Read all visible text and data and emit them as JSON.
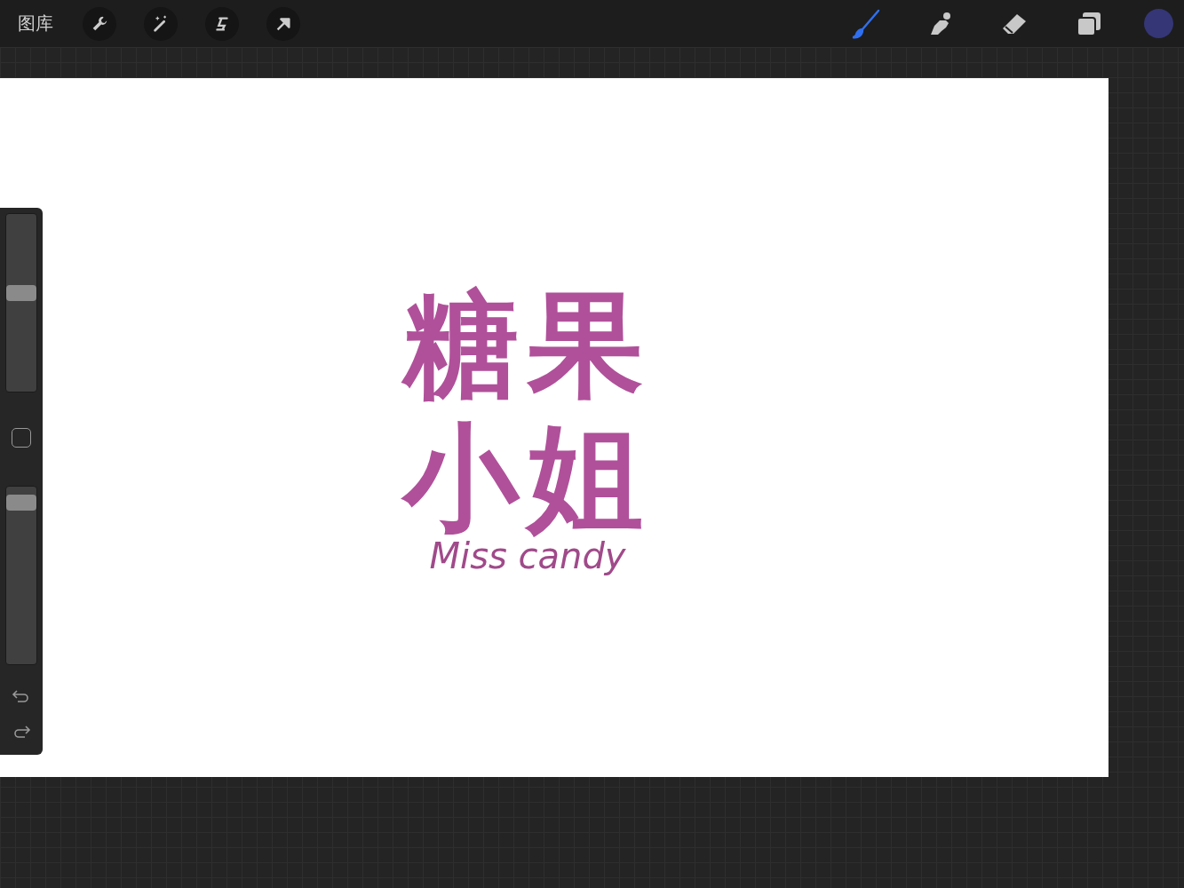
{
  "top_bar": {
    "gallery_label": "图库",
    "left_tools": [
      {
        "kind": "wrench"
      },
      {
        "kind": "wand"
      },
      {
        "kind": "select"
      },
      {
        "kind": "arrow"
      }
    ],
    "right_tools": [
      {
        "kind": "brush",
        "selected": true
      },
      {
        "kind": "smudge",
        "selected": false
      },
      {
        "kind": "eraser",
        "selected": false
      },
      {
        "kind": "layers",
        "selected": false
      }
    ],
    "color": "#343676"
  },
  "canvas": {
    "title_chars": "糖果小姐",
    "subtitle": "Miss candy"
  },
  "sidebar": {
    "size_slider": {
      "level": 0.56
    },
    "opacity_slider": {
      "level": 0.95
    }
  }
}
